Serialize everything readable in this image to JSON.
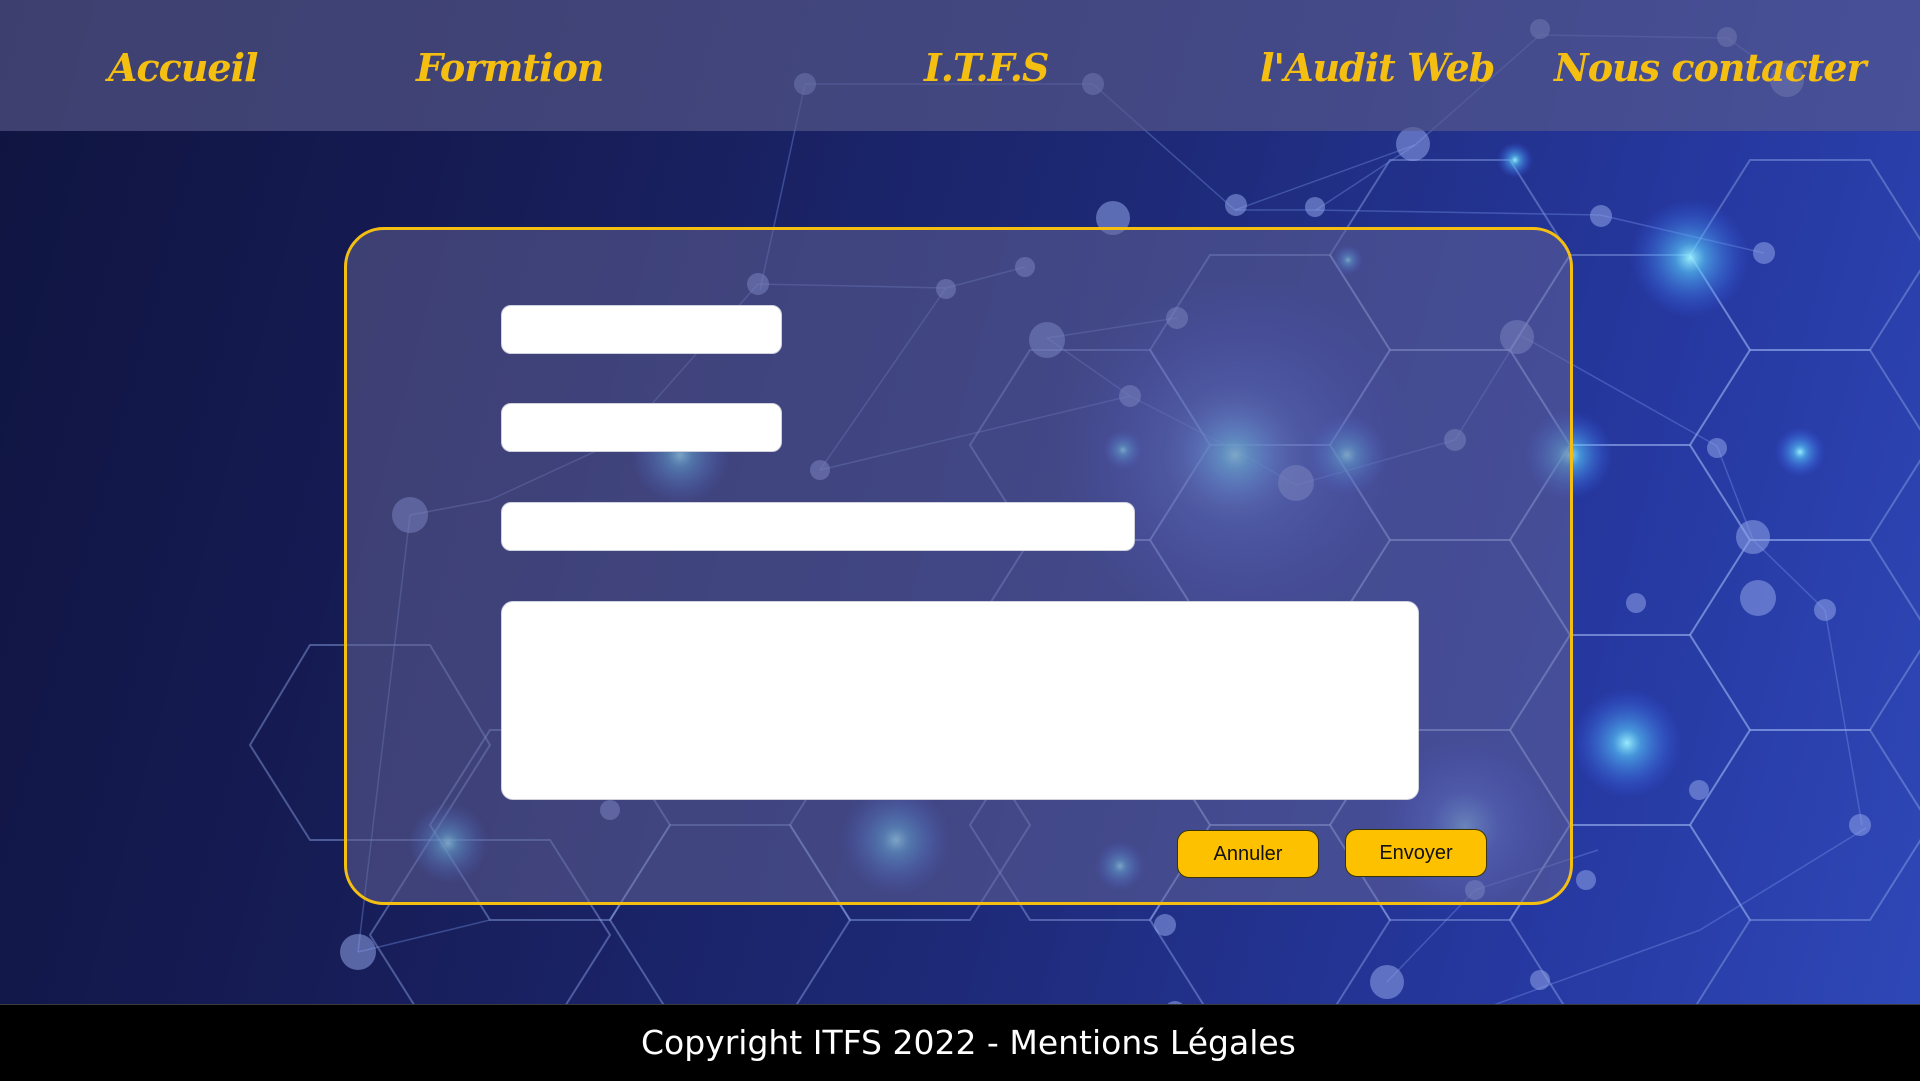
{
  "nav": {
    "items": [
      {
        "label": "Accueil"
      },
      {
        "label": "Formtion"
      },
      {
        "label": "I.T.F.S"
      },
      {
        "label": "l'Audit Web"
      },
      {
        "label": "Nous contacter"
      }
    ]
  },
  "form": {
    "field_1_value": "",
    "field_2_value": "",
    "field_3_value": "",
    "message_value": "",
    "cancel_label": "Annuler",
    "submit_label": "Envoyer"
  },
  "footer": {
    "copyright": "Copyright ITFS 2022 - ",
    "legal_link": "Mentions Légales"
  },
  "colors": {
    "accent": "#f5bf12",
    "button": "#fdc100",
    "background_dark": "#0f1440",
    "background_light": "#2f48b8",
    "footer_bg": "#000000"
  }
}
